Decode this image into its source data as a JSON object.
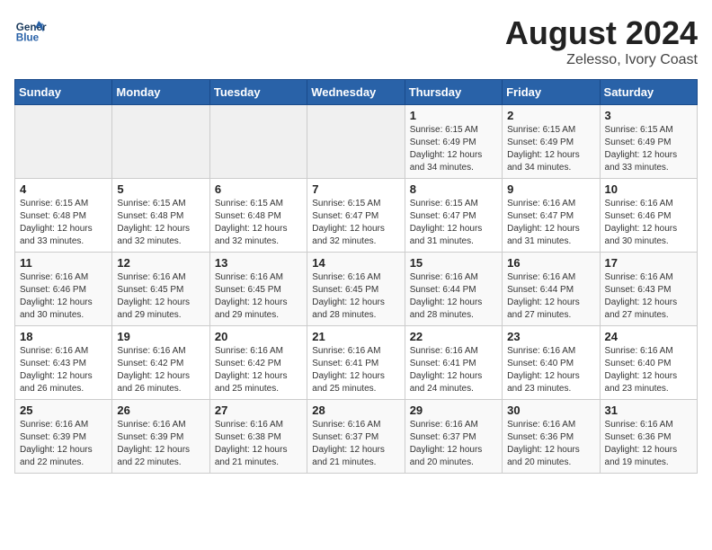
{
  "app": {
    "name": "GeneralBlue",
    "logo_color": "#1a3a5c"
  },
  "title": "August 2024",
  "subtitle": "Zelesso, Ivory Coast",
  "header_days": [
    "Sunday",
    "Monday",
    "Tuesday",
    "Wednesday",
    "Thursday",
    "Friday",
    "Saturday"
  ],
  "weeks": [
    [
      {
        "day": "",
        "sunrise": "",
        "sunset": "",
        "daylight": ""
      },
      {
        "day": "",
        "sunrise": "",
        "sunset": "",
        "daylight": ""
      },
      {
        "day": "",
        "sunrise": "",
        "sunset": "",
        "daylight": ""
      },
      {
        "day": "",
        "sunrise": "",
        "sunset": "",
        "daylight": ""
      },
      {
        "day": "1",
        "sunrise": "Sunrise: 6:15 AM",
        "sunset": "Sunset: 6:49 PM",
        "daylight": "Daylight: 12 hours and 34 minutes."
      },
      {
        "day": "2",
        "sunrise": "Sunrise: 6:15 AM",
        "sunset": "Sunset: 6:49 PM",
        "daylight": "Daylight: 12 hours and 34 minutes."
      },
      {
        "day": "3",
        "sunrise": "Sunrise: 6:15 AM",
        "sunset": "Sunset: 6:49 PM",
        "daylight": "Daylight: 12 hours and 33 minutes."
      }
    ],
    [
      {
        "day": "4",
        "sunrise": "Sunrise: 6:15 AM",
        "sunset": "Sunset: 6:48 PM",
        "daylight": "Daylight: 12 hours and 33 minutes."
      },
      {
        "day": "5",
        "sunrise": "Sunrise: 6:15 AM",
        "sunset": "Sunset: 6:48 PM",
        "daylight": "Daylight: 12 hours and 32 minutes."
      },
      {
        "day": "6",
        "sunrise": "Sunrise: 6:15 AM",
        "sunset": "Sunset: 6:48 PM",
        "daylight": "Daylight: 12 hours and 32 minutes."
      },
      {
        "day": "7",
        "sunrise": "Sunrise: 6:15 AM",
        "sunset": "Sunset: 6:47 PM",
        "daylight": "Daylight: 12 hours and 32 minutes."
      },
      {
        "day": "8",
        "sunrise": "Sunrise: 6:15 AM",
        "sunset": "Sunset: 6:47 PM",
        "daylight": "Daylight: 12 hours and 31 minutes."
      },
      {
        "day": "9",
        "sunrise": "Sunrise: 6:16 AM",
        "sunset": "Sunset: 6:47 PM",
        "daylight": "Daylight: 12 hours and 31 minutes."
      },
      {
        "day": "10",
        "sunrise": "Sunrise: 6:16 AM",
        "sunset": "Sunset: 6:46 PM",
        "daylight": "Daylight: 12 hours and 30 minutes."
      }
    ],
    [
      {
        "day": "11",
        "sunrise": "Sunrise: 6:16 AM",
        "sunset": "Sunset: 6:46 PM",
        "daylight": "Daylight: 12 hours and 30 minutes."
      },
      {
        "day": "12",
        "sunrise": "Sunrise: 6:16 AM",
        "sunset": "Sunset: 6:45 PM",
        "daylight": "Daylight: 12 hours and 29 minutes."
      },
      {
        "day": "13",
        "sunrise": "Sunrise: 6:16 AM",
        "sunset": "Sunset: 6:45 PM",
        "daylight": "Daylight: 12 hours and 29 minutes."
      },
      {
        "day": "14",
        "sunrise": "Sunrise: 6:16 AM",
        "sunset": "Sunset: 6:45 PM",
        "daylight": "Daylight: 12 hours and 28 minutes."
      },
      {
        "day": "15",
        "sunrise": "Sunrise: 6:16 AM",
        "sunset": "Sunset: 6:44 PM",
        "daylight": "Daylight: 12 hours and 28 minutes."
      },
      {
        "day": "16",
        "sunrise": "Sunrise: 6:16 AM",
        "sunset": "Sunset: 6:44 PM",
        "daylight": "Daylight: 12 hours and 27 minutes."
      },
      {
        "day": "17",
        "sunrise": "Sunrise: 6:16 AM",
        "sunset": "Sunset: 6:43 PM",
        "daylight": "Daylight: 12 hours and 27 minutes."
      }
    ],
    [
      {
        "day": "18",
        "sunrise": "Sunrise: 6:16 AM",
        "sunset": "Sunset: 6:43 PM",
        "daylight": "Daylight: 12 hours and 26 minutes."
      },
      {
        "day": "19",
        "sunrise": "Sunrise: 6:16 AM",
        "sunset": "Sunset: 6:42 PM",
        "daylight": "Daylight: 12 hours and 26 minutes."
      },
      {
        "day": "20",
        "sunrise": "Sunrise: 6:16 AM",
        "sunset": "Sunset: 6:42 PM",
        "daylight": "Daylight: 12 hours and 25 minutes."
      },
      {
        "day": "21",
        "sunrise": "Sunrise: 6:16 AM",
        "sunset": "Sunset: 6:41 PM",
        "daylight": "Daylight: 12 hours and 25 minutes."
      },
      {
        "day": "22",
        "sunrise": "Sunrise: 6:16 AM",
        "sunset": "Sunset: 6:41 PM",
        "daylight": "Daylight: 12 hours and 24 minutes."
      },
      {
        "day": "23",
        "sunrise": "Sunrise: 6:16 AM",
        "sunset": "Sunset: 6:40 PM",
        "daylight": "Daylight: 12 hours and 23 minutes."
      },
      {
        "day": "24",
        "sunrise": "Sunrise: 6:16 AM",
        "sunset": "Sunset: 6:40 PM",
        "daylight": "Daylight: 12 hours and 23 minutes."
      }
    ],
    [
      {
        "day": "25",
        "sunrise": "Sunrise: 6:16 AM",
        "sunset": "Sunset: 6:39 PM",
        "daylight": "Daylight: 12 hours and 22 minutes."
      },
      {
        "day": "26",
        "sunrise": "Sunrise: 6:16 AM",
        "sunset": "Sunset: 6:39 PM",
        "daylight": "Daylight: 12 hours and 22 minutes."
      },
      {
        "day": "27",
        "sunrise": "Sunrise: 6:16 AM",
        "sunset": "Sunset: 6:38 PM",
        "daylight": "Daylight: 12 hours and 21 minutes."
      },
      {
        "day": "28",
        "sunrise": "Sunrise: 6:16 AM",
        "sunset": "Sunset: 6:37 PM",
        "daylight": "Daylight: 12 hours and 21 minutes."
      },
      {
        "day": "29",
        "sunrise": "Sunrise: 6:16 AM",
        "sunset": "Sunset: 6:37 PM",
        "daylight": "Daylight: 12 hours and 20 minutes."
      },
      {
        "day": "30",
        "sunrise": "Sunrise: 6:16 AM",
        "sunset": "Sunset: 6:36 PM",
        "daylight": "Daylight: 12 hours and 20 minutes."
      },
      {
        "day": "31",
        "sunrise": "Sunrise: 6:16 AM",
        "sunset": "Sunset: 6:36 PM",
        "daylight": "Daylight: 12 hours and 19 minutes."
      }
    ]
  ]
}
